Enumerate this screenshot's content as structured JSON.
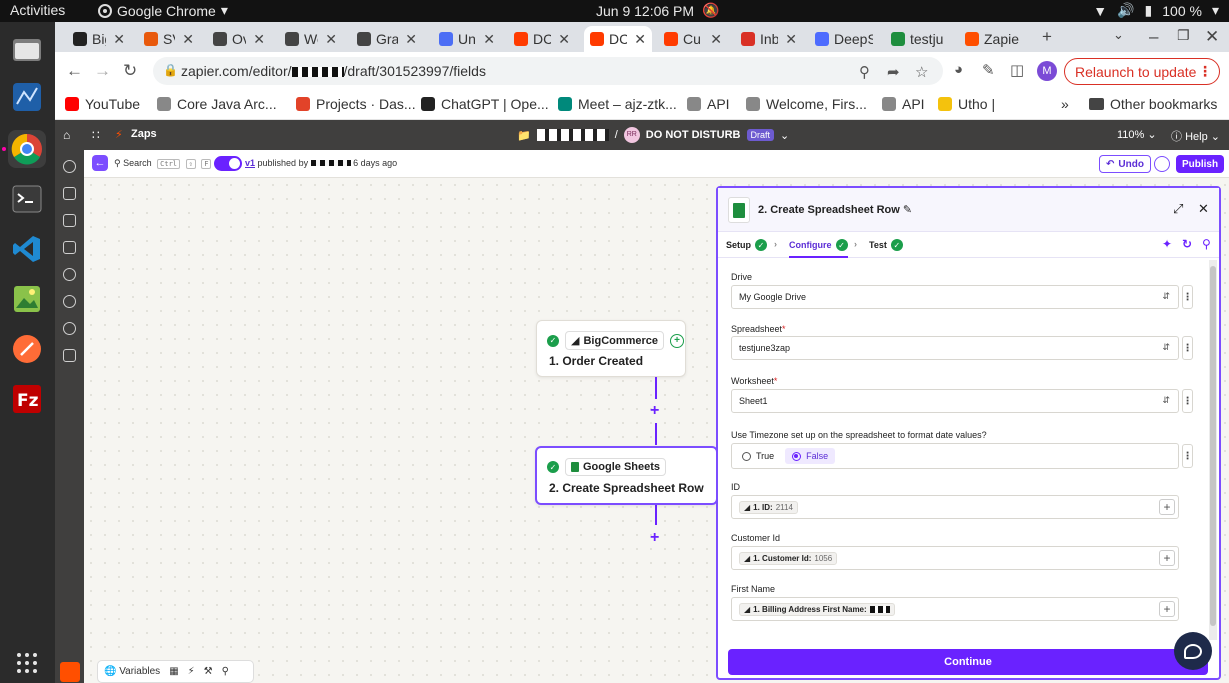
{
  "system": {
    "activities": "Activities",
    "app_name": "Google Chrome",
    "clock": "Jun 9  12:06 PM",
    "battery": "100 %"
  },
  "tabs": [
    {
      "label": "Big",
      "color": "#222222"
    },
    {
      "label": "SV",
      "color": "#e8590c"
    },
    {
      "label": "Ov",
      "color": "#444444"
    },
    {
      "label": "We",
      "color": "#444444"
    },
    {
      "label": "Gra",
      "color": "#444444"
    },
    {
      "label": "Un",
      "color": "#4c6ef5"
    },
    {
      "label": "DC",
      "color": "#ff3b00"
    },
    {
      "label": "DC",
      "color": "#ff3b00"
    },
    {
      "label": "Cu",
      "color": "#ff3b00"
    },
    {
      "label": "Inb",
      "color": "#d93025"
    },
    {
      "label": "DeepS",
      "color": "#4d6bfe"
    },
    {
      "label": "testju",
      "color": "#1e8e3e"
    },
    {
      "label": "Zapie",
      "color": "#ff4f00"
    }
  ],
  "browser": {
    "url_prefix": "zapier.com/editor/",
    "url_suffix": "/draft/301523997/fields",
    "profile_initial": "M",
    "relaunch_label": "Relaunch to update"
  },
  "bookmarks": [
    {
      "label": "YouTube",
      "color": "#ff0000"
    },
    {
      "label": "Core Java Arc...",
      "color": "#888888"
    },
    {
      "label": "Projects · Das...",
      "color": "#e24329"
    },
    {
      "label": "ChatGPT | Ope...",
      "color": "#222222"
    },
    {
      "label": "Meet – ajz-ztk...",
      "color": "#00897b"
    },
    {
      "label": "API",
      "color": "#888888"
    },
    {
      "label": "Welcome, Firs...",
      "color": "#888888"
    },
    {
      "label": "API",
      "color": "#888888"
    },
    {
      "label": "Utho |",
      "color": "#f4c20d"
    }
  ],
  "other_bookmarks": "Other bookmarks",
  "zap_header": {
    "zaps_label": "Zaps",
    "avatar_initials": "RR",
    "zap_name": "DO NOT DISTURB",
    "status_badge": "Draft",
    "zoom": "110%",
    "help": "Help"
  },
  "subbar": {
    "search_label": "Search",
    "kbd_ctrl": "Ctrl",
    "kbd_shift": "⇧",
    "kbd_f": "F",
    "version": "v1",
    "published_by": "published by",
    "published_ago": "6 days ago",
    "undo": "Undo",
    "publish": "Publish"
  },
  "steps": [
    {
      "app": "BigCommerce",
      "title": "1. Order Created"
    },
    {
      "app": "Google Sheets",
      "title": "2. Create Spreadsheet Row"
    }
  ],
  "bottom_toolbar": {
    "variables": "Variables"
  },
  "panel": {
    "title": "2. Create Spreadsheet Row",
    "tabs": [
      {
        "label": "Setup"
      },
      {
        "label": "Configure"
      },
      {
        "label": "Test"
      }
    ],
    "fields": {
      "drive": {
        "label": "Drive",
        "value": "My Google Drive"
      },
      "spreadsheet": {
        "label": "Spreadsheet",
        "value": "testjune3zap"
      },
      "worksheet": {
        "label": "Worksheet",
        "value": "Sheet1"
      },
      "timezone": {
        "label": "Use Timezone set up on the spreadsheet to format date values?",
        "opt_true": "True",
        "opt_false": "False",
        "selected": "False"
      },
      "id": {
        "label": "ID",
        "token": "1. ID:",
        "sample": "2114"
      },
      "customer_id": {
        "label": "Customer Id",
        "token": "1. Customer Id:",
        "sample": "1056"
      },
      "first_name": {
        "label": "First Name",
        "token": "1. Billing Address First Name:"
      }
    },
    "continue_label": "Continue"
  },
  "colors": {
    "zapier_purple": "#6a22ff",
    "success_green": "#1b9e4b",
    "relaunch_red": "#d93025"
  }
}
